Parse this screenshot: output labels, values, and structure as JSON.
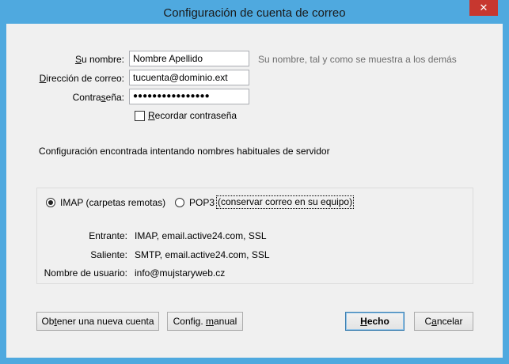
{
  "window": {
    "title": "Configuración de cuenta de correo",
    "close_glyph": "✕"
  },
  "form": {
    "name_label_accel": "S",
    "name_label_rest": "u nombre:",
    "name_value": "Nombre Apellido",
    "name_hint": "Su nombre, tal y como se muestra a los demás",
    "email_label_accel": "D",
    "email_label_rest": "irección de correo:",
    "email_value": "tucuenta@dominio.ext",
    "password_label_pre": "Contra",
    "password_label_accel": "s",
    "password_label_post": "eña:",
    "password_value": "●●●●●●●●●●●●●●●●",
    "remember_accel": "R",
    "remember_rest": "ecordar contraseña",
    "remember_checked": false
  },
  "status_message": "Configuración encontrada intentando nombres habituales de servidor",
  "protocol": {
    "imap_label": "IMAP (carpetas remotas)",
    "pop3_label": "POP3",
    "pop3_detail": "(conservar correo en su equipo)",
    "selected": "IMAP"
  },
  "server": {
    "incoming_label": "Entrante:",
    "incoming_value": "IMAP, email.active24.com, SSL",
    "outgoing_label": "Saliente:",
    "outgoing_value": "SMTP, email.active24.com, SSL",
    "username_label": "Nombre de usuario:",
    "username_value": "info@mujstaryweb.cz"
  },
  "buttons": {
    "new_account_pre": "Ob",
    "new_account_accel": "t",
    "new_account_post": "ener una nueva cuenta",
    "manual_pre": "Config. ",
    "manual_accel": "m",
    "manual_post": "anual",
    "done_accel": "H",
    "done_rest": "echo",
    "cancel_pre": "C",
    "cancel_accel": "a",
    "cancel_post": "ncelar"
  }
}
